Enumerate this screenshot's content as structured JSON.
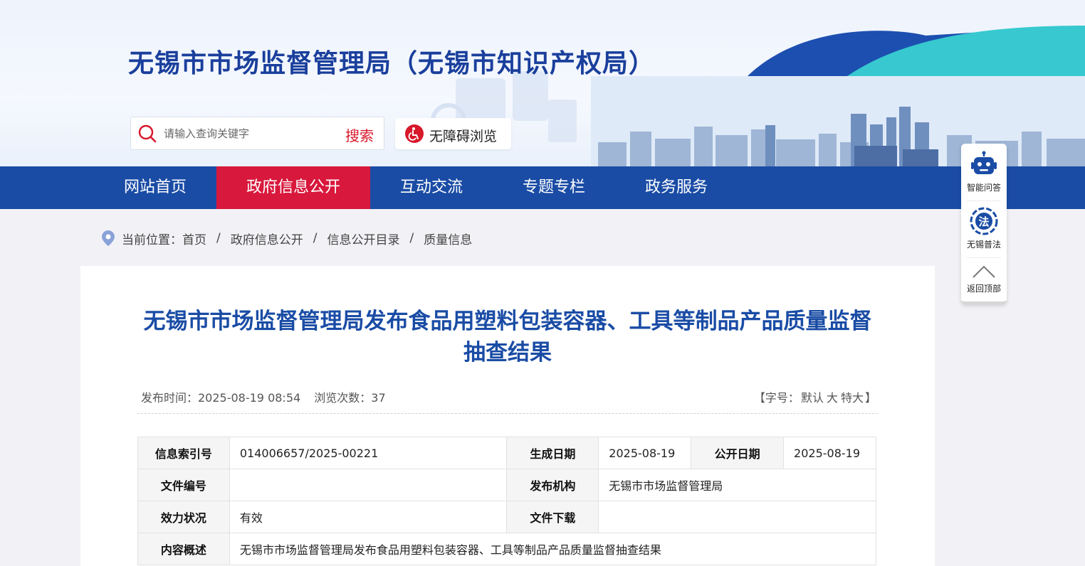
{
  "header": {
    "site_title": "无锡市市场监督管理局（无锡市知识产权局）",
    "search_placeholder": "请输入查询关键字",
    "search_button": "搜索",
    "accessibility_label": "无障碍浏览"
  },
  "nav": {
    "items": [
      {
        "label": "网站首页",
        "active": false
      },
      {
        "label": "政府信息公开",
        "active": true
      },
      {
        "label": "互动交流",
        "active": false
      },
      {
        "label": "专题专栏",
        "active": false
      },
      {
        "label": "政务服务",
        "active": false
      }
    ]
  },
  "breadcrumb": {
    "prefix": "当前位置：",
    "items": [
      "首页",
      "政府信息公开",
      "信息公开目录",
      "质量信息"
    ],
    "separator": "/"
  },
  "article": {
    "title": "无锡市市场监督管理局发布食品用塑料包装容器、工具等制品产品质量监督抽查结果",
    "publish_time": "发布时间：2025-08-19 08:54",
    "views": "浏览次数：37",
    "font_size": {
      "prefix": "【字号：",
      "options": [
        "默认",
        "大",
        "特大"
      ],
      "suffix": "】"
    }
  },
  "info_table": {
    "index_label": "信息索引号",
    "index_value": "014006657/2025-00221",
    "created_label": "生成日期",
    "created_value": "2025-08-19",
    "public_label": "公开日期",
    "public_value": "2025-08-19",
    "doc_no_label": "文件编号",
    "doc_no_value": "",
    "issuer_label": "发布机构",
    "issuer_value": "无锡市市场监督管理局",
    "validity_label": "效力状况",
    "validity_value": "有效",
    "download_label": "文件下载",
    "download_value": "",
    "summary_label": "内容概述",
    "summary_value": "无锡市市场监督管理局发布食品用塑料包装容器、工具等制品产品质量监督抽查结果"
  },
  "float_bar": {
    "qa_label": "智能问答",
    "law_label": "无锡普法",
    "law_glyph": "法",
    "top_label": "返回顶部"
  },
  "colors": {
    "brand_blue": "#1a4ca5",
    "title_blue": "#1a3f9c",
    "active_red": "#d8183c",
    "search_red": "#d8182b"
  }
}
